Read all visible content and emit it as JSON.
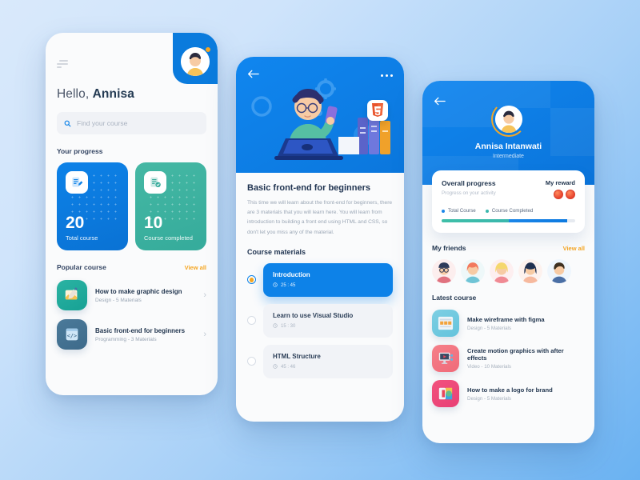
{
  "background": {
    "from": "#d9e9fb",
    "to": "#6ab2f2"
  },
  "theme": {
    "blue": "#0d82e8",
    "teal": "#35ab9b",
    "amber": "#f5a623",
    "dark": "#22364f"
  },
  "phone_home": {
    "menu_icon": "hamburger-icon",
    "avatar_icon": "user-avatar",
    "greeting_hello": "Hello, ",
    "greeting_name": "Annisa",
    "search": {
      "icon": "search-icon",
      "placeholder": "Find your course"
    },
    "progress_heading": "Your progress",
    "progress_cards": [
      {
        "icon": "document-edit-icon",
        "value": "20",
        "label": "Total course",
        "color": "#0d82e8"
      },
      {
        "icon": "document-check-icon",
        "value": "10",
        "label": "Course completed",
        "color": "#35ab9b"
      }
    ],
    "popular_heading": "Popular course",
    "view_all": "View all",
    "popular_courses": [
      {
        "icon": "design-pencil-icon",
        "title": "How to make graphic design",
        "meta": "Design - 5 Materials",
        "chevron": "›"
      },
      {
        "icon": "code-brackets-icon",
        "title": "Basic front-end for beginners",
        "meta": "Programming - 3 Materials",
        "chevron": "›"
      }
    ]
  },
  "phone_detail": {
    "back_icon": "back-arrow-icon",
    "more_icon": "more-options-icon",
    "hero_icon": "html5-badge-icon",
    "title": "Basic front-end for beginners",
    "description": "This time we will learn about the front-end for beginners, there are 3 materials that you will learn here. You will learn from introduction to building a front end using HTML and CSS, so don't let you miss any of the material.",
    "materials_heading": "Course materials",
    "materials": [
      {
        "name": "Introduction",
        "time": "25 : 45",
        "state": "active",
        "clock_icon": "clock-icon"
      },
      {
        "name": "Learn to use Visual Studio",
        "time": "15 : 30",
        "state": "idle",
        "clock_icon": "clock-icon"
      },
      {
        "name": "HTML Structure",
        "time": "45 : 46",
        "state": "idle",
        "clock_icon": "clock-icon"
      }
    ]
  },
  "phone_profile": {
    "back_icon": "back-arrow-icon",
    "avatar_icon": "user-avatar",
    "name": "Annisa Intanwati",
    "level": "Intermediate",
    "overall": {
      "heading": "Overall progress",
      "sub": "Progress on your activity",
      "reward_label": "My reward",
      "medals": [
        "medal-icon",
        "medal-icon"
      ],
      "legend": [
        {
          "label": "Total Course",
          "color": "#1b86e8"
        },
        {
          "label": "Course Completed",
          "color": "#3ab7ad"
        }
      ],
      "bar": {
        "completed_pct": 50,
        "total_pct": 44
      }
    },
    "friends_heading": "My friends",
    "friends_view_all": "View all",
    "friends": [
      "friend-avatar-1",
      "friend-avatar-2",
      "friend-avatar-3",
      "friend-avatar-4",
      "friend-avatar-5"
    ],
    "latest_heading": "Latest course",
    "latest_courses": [
      {
        "icon": "wireframe-icon",
        "title": "Make wireframe with figma",
        "meta": "Design - 5 Materials"
      },
      {
        "icon": "monitor-play-icon",
        "title": "Create motion graphics with after effects",
        "meta": "Video - 10 Materials"
      },
      {
        "icon": "logo-shapes-icon",
        "title": "How to make a logo for brand",
        "meta": "Design - 5 Materials"
      }
    ]
  }
}
